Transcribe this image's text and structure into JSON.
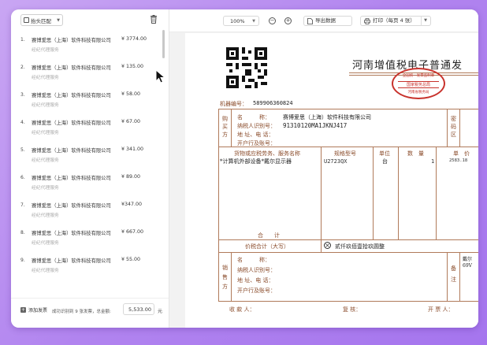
{
  "left_panel": {
    "filter_label": "抬头匹配",
    "items": [
      {
        "num": "1.",
        "company": "赛博爱思（上海）软件科技有限公司",
        "amount": "¥ 3774.00",
        "sub": "经纪代理服务"
      },
      {
        "num": "2.",
        "company": "赛博爱思（上海）软件科技有限公司",
        "amount": "¥ 135.00",
        "sub": "经纪代理服务"
      },
      {
        "num": "3.",
        "company": "赛博爱思（上海）软件科技有限公司",
        "amount": "¥ 58.00",
        "sub": "经纪代理服务"
      },
      {
        "num": "4.",
        "company": "赛博爱思（上海）软件科技有限公司",
        "amount": "¥ 67.00",
        "sub": "经纪代理服务"
      },
      {
        "num": "5.",
        "company": "赛博爱思（上海）软件科技有限公司",
        "amount": "¥ 341.00",
        "sub": "经纪代理服务"
      },
      {
        "num": "6.",
        "company": "赛博爱思（上海）软件科技有限公司",
        "amount": "¥ 89.00",
        "sub": "经纪代理服务"
      },
      {
        "num": "7.",
        "company": "赛博爱思（上海）软件科技有限公司",
        "amount": "¥347.00",
        "sub": "经纪代理服务"
      },
      {
        "num": "8.",
        "company": "赛博爱思（上海）软件科技有限公司",
        "amount": "¥ 667.00",
        "sub": "经纪代理服务"
      },
      {
        "num": "9.",
        "company": "赛博爱思（上海）软件科技有限公司",
        "amount": "¥ 55.00",
        "sub": "经纪代理服务"
      }
    ],
    "add_label": "添加发票",
    "summary": "成功识别到 9 张发票，总金额:",
    "total": "5,533.00",
    "currency": "元"
  },
  "toolbar": {
    "zoom": "100%",
    "zoom_out": "−",
    "zoom_in": "+",
    "export_label": "导出数据",
    "print_label": "打印（每页 4 张）"
  },
  "invoice": {
    "title": "河南增值税电子普通发",
    "stamp_top": "全国统一发票监制章",
    "stamp_mid": "国家税务总局",
    "stamp_bottom": "河南省税务局",
    "machine_no_label": "机器编号：",
    "machine_no": "589906360824",
    "buyer_side": "购买方",
    "buyer_name_label": "名　　　称：",
    "buyer_name": "赛博爱思（上海）软件科技有限公司",
    "buyer_tax_label": "纳税人识别号：",
    "buyer_tax": "91310120MA1JKNJ417",
    "buyer_addr_label": "地 址、电 话：",
    "buyer_bank_label": "开户行及账号：",
    "password_area": "密码区",
    "col_goods": "货物或应税劳务、服务名称",
    "col_spec": "规格型号",
    "col_unit": "单位",
    "col_qty": "数　量",
    "col_price": "单　价",
    "goods_name": "*计算机外部设备*戴尔显示器",
    "goods_spec": "U2723QX",
    "goods_unit": "台",
    "goods_qty": "1",
    "goods_price": "2583.18",
    "sum_label": "合　　计",
    "total_label": "价税合计（大写）",
    "total_upper": "贰仟玖佰壹拾玖圆整",
    "seller_side": "销售方",
    "seller_name_label": "名　　　称：",
    "seller_tax_label": "纳税人识别号：",
    "seller_addr_label": "地 址、电 话：",
    "seller_bank_label": "开户行及账号：",
    "remark": "备注",
    "remark_val1": "戴尔",
    "remark_val2": "69V",
    "payee_label": "收 款 人：",
    "reviewer_label": "复 核：",
    "issuer_label": "开 票 人："
  },
  "colors": {
    "frame": "#b184ef",
    "invoice_brown": "#8a4b2a",
    "stamp_red": "#c8322c"
  }
}
